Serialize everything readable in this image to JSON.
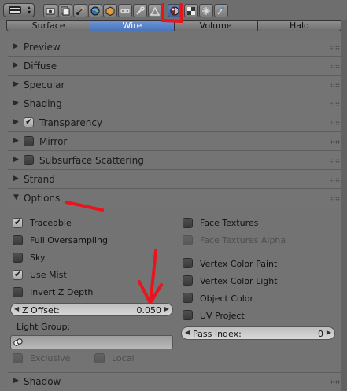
{
  "toolbar": {
    "editor_type": "properties-editor-menu",
    "context_icons": [
      "render-icon",
      "render-layers-icon",
      "scene-icon",
      "world-icon",
      "object-icon",
      "constraints-icon",
      "modifiers-icon",
      "object-data-icon",
      "material-icon",
      "texture-icon",
      "particles-icon",
      "physics-icon"
    ],
    "active_context": "material-icon"
  },
  "shader_tabs": [
    "Surface",
    "Wire",
    "Volume",
    "Halo"
  ],
  "selected_tab": "Wire",
  "panels": {
    "preview": "Preview",
    "diffuse": "Diffuse",
    "specular": "Specular",
    "shading": "Shading",
    "transparency": "Transparency",
    "mirror": "Mirror",
    "sss": "Subsurface Scattering",
    "strand": "Strand",
    "options": "Options",
    "shadow": "Shadow"
  },
  "panel_checks": {
    "transparency": true,
    "mirror": false,
    "sss": false
  },
  "options": {
    "left": [
      {
        "label": "Traceable",
        "checked": true,
        "enabled": true
      },
      {
        "label": "Full Oversampling",
        "checked": false,
        "enabled": true
      },
      {
        "label": "Sky",
        "checked": false,
        "enabled": true
      },
      {
        "label": "Use Mist",
        "checked": true,
        "enabled": true
      },
      {
        "label": "Invert Z Depth",
        "checked": false,
        "enabled": true
      }
    ],
    "right": [
      {
        "label": "Face Textures",
        "checked": false,
        "enabled": true
      },
      {
        "label": "Face Textures Alpha",
        "checked": false,
        "enabled": false
      },
      {
        "label": "Vertex Color Paint",
        "checked": false,
        "enabled": true
      },
      {
        "label": "Vertex Color Light",
        "checked": false,
        "enabled": true
      },
      {
        "label": "Object Color",
        "checked": false,
        "enabled": true
      },
      {
        "label": "UV Project",
        "checked": false,
        "enabled": true
      }
    ],
    "z_offset_label": "Z Offset:",
    "z_offset_value": "0.050",
    "pass_index_label": "Pass Index:",
    "pass_index_value": "0",
    "light_group_label": "Light Group:",
    "light_group_value": "",
    "exclusive_label": "Exclusive",
    "local_label": "Local"
  },
  "colors": {
    "selected_tab": "#5a84c8",
    "annotation": "#e8141e",
    "background": "#737373"
  }
}
